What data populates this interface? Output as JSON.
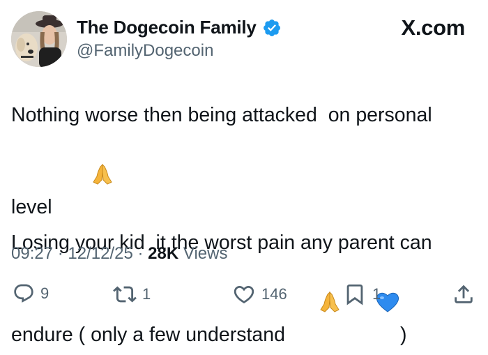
{
  "tweet": {
    "display_name": "The Dogecoin Family",
    "handle": "@FamilyDogecoin",
    "brand": "X.com",
    "lines": [
      "Nothing worse then being attacked  on personal",
      "level",
      "Losing your kid  it the worst pain any parent can",
      "endure ( only a few understand",
      ")"
    ],
    "emojis": [
      "folded-hands",
      "folded-hands",
      "blue-heart"
    ],
    "time": "09:27",
    "date": "12/12/25",
    "views_count": "28K",
    "views_label": "Views",
    "separator": "·"
  },
  "actions": {
    "replies": "9",
    "reposts": "1",
    "likes": "146",
    "bookmarks": "1"
  },
  "colors": {
    "text": "#0f1419",
    "secondary": "#536471",
    "verified": "#1d9bf0",
    "heart_emoji": "#2e8bef",
    "hands_emoji": "#f5b43b"
  },
  "icons": [
    "verified-badge-icon",
    "reply-icon",
    "repost-icon",
    "like-icon",
    "bookmark-icon",
    "share-icon"
  ]
}
